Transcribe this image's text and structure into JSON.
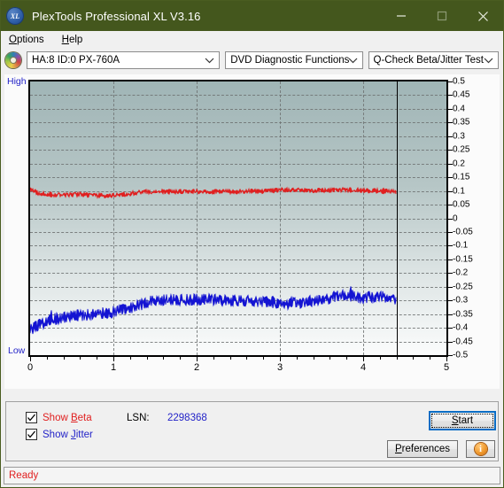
{
  "window": {
    "title": "PlexTools Professional XL V3.16",
    "app_icon": "xl-disc-icon",
    "icon_text": "XL",
    "titlebar_color": "#44571d",
    "minimize_label": "Minimize",
    "maximize_label": "Maximize",
    "close_label": "Close"
  },
  "menubar": {
    "items": [
      {
        "label": "Options",
        "accel": "O"
      },
      {
        "label": "Help",
        "accel": "H"
      }
    ]
  },
  "toolbar": {
    "drive_icon": "optical-disc-icon",
    "drive_combo": {
      "value": "HA:8 ID:0  PX-760A",
      "options": [
        "HA:8 ID:0  PX-760A"
      ]
    },
    "function_combo": {
      "value": "DVD Diagnostic Functions",
      "options": [
        "DVD Diagnostic Functions"
      ]
    },
    "test_combo": {
      "value": "Q-Check Beta/Jitter Test",
      "options": [
        "Q-Check Beta/Jitter Test"
      ]
    }
  },
  "chart_labels": {
    "high": "High",
    "low": "Low"
  },
  "controls": {
    "show_beta": {
      "label": "Show Beta",
      "accel": "B",
      "checked": true,
      "color": "#e02020"
    },
    "show_jitter": {
      "label": "Show Jitter",
      "accel": "J",
      "checked": true,
      "color": "#2323c8"
    },
    "lsn_label": "LSN:",
    "lsn_value": "2298368",
    "start_button": "Start",
    "start_accel": "S",
    "preferences_button": "Preferences",
    "preferences_accel": "P",
    "info_button": "i"
  },
  "statusbar": {
    "text": "Ready"
  },
  "chart_data": {
    "type": "line",
    "title": "Q-Check Beta/Jitter Test",
    "xlabel": "",
    "ylabel": "",
    "xlim": [
      0,
      5
    ],
    "ylim": [
      -0.5,
      0.5
    ],
    "xticks": [
      0,
      1,
      2,
      3,
      4,
      5
    ],
    "yticks": [
      0.5,
      0.45,
      0.4,
      0.35,
      0.3,
      0.25,
      0.2,
      0.15,
      0.1,
      0.05,
      0,
      -0.05,
      -0.1,
      -0.15,
      -0.2,
      -0.25,
      -0.3,
      -0.35,
      -0.4,
      -0.45,
      -0.5
    ],
    "ytick_labels": [
      "0.5",
      "0.45",
      "0.4",
      "0.35",
      "0.3",
      "0.25",
      "0.2",
      "0.15",
      "0.1",
      "0.05",
      "0",
      "-0.05",
      "-0.1",
      "-0.15",
      "-0.2",
      "-0.25",
      "-0.3",
      "-0.35",
      "-0.4",
      "-0.45",
      "-0.5"
    ],
    "xtick_labels": [
      "0",
      "1",
      "2",
      "3",
      "4",
      "5"
    ],
    "minor_xtick_step": 0.2,
    "grid": true,
    "grid_style": "dashed",
    "legend_position": "bottom-left-checkboxes",
    "data_end_x": 4.4,
    "marker_line_x": 4.4,
    "series": [
      {
        "name": "Beta",
        "color": "#e02020",
        "x": [
          0.0,
          0.1,
          0.2,
          0.3,
          0.4,
          0.5,
          0.6,
          0.7,
          0.8,
          0.9,
          1.0,
          1.1,
          1.2,
          1.3,
          1.4,
          1.5,
          1.6,
          1.7,
          1.8,
          1.9,
          2.0,
          2.1,
          2.2,
          2.3,
          2.4,
          2.5,
          2.6,
          2.7,
          2.8,
          2.9,
          3.0,
          3.1,
          3.2,
          3.3,
          3.4,
          3.5,
          3.6,
          3.7,
          3.8,
          3.9,
          4.0,
          4.1,
          4.2,
          4.3,
          4.4
        ],
        "values": [
          0.105,
          0.092,
          0.088,
          0.086,
          0.085,
          0.086,
          0.087,
          0.085,
          0.084,
          0.083,
          0.084,
          0.086,
          0.09,
          0.095,
          0.097,
          0.098,
          0.098,
          0.097,
          0.097,
          0.098,
          0.098,
          0.098,
          0.097,
          0.097,
          0.097,
          0.098,
          0.099,
          0.099,
          0.099,
          0.1,
          0.103,
          0.104,
          0.104,
          0.103,
          0.102,
          0.102,
          0.103,
          0.104,
          0.104,
          0.103,
          0.102,
          0.101,
          0.1,
          0.099,
          0.097
        ],
        "noise_amplitude": 0.009
      },
      {
        "name": "Jitter",
        "color": "#1414d2",
        "x": [
          0.0,
          0.1,
          0.2,
          0.3,
          0.4,
          0.5,
          0.6,
          0.7,
          0.8,
          0.9,
          1.0,
          1.1,
          1.2,
          1.3,
          1.4,
          1.5,
          1.6,
          1.7,
          1.8,
          1.9,
          2.0,
          2.1,
          2.2,
          2.3,
          2.4,
          2.5,
          2.6,
          2.7,
          2.8,
          2.9,
          3.0,
          3.1,
          3.2,
          3.3,
          3.4,
          3.5,
          3.6,
          3.7,
          3.8,
          3.9,
          4.0,
          4.1,
          4.2,
          4.3,
          4.4
        ],
        "values": [
          -0.405,
          -0.392,
          -0.378,
          -0.368,
          -0.362,
          -0.358,
          -0.355,
          -0.352,
          -0.348,
          -0.345,
          -0.342,
          -0.336,
          -0.328,
          -0.318,
          -0.306,
          -0.3,
          -0.299,
          -0.299,
          -0.298,
          -0.297,
          -0.296,
          -0.297,
          -0.298,
          -0.299,
          -0.299,
          -0.3,
          -0.301,
          -0.302,
          -0.304,
          -0.306,
          -0.31,
          -0.312,
          -0.31,
          -0.304,
          -0.3,
          -0.296,
          -0.29,
          -0.284,
          -0.276,
          -0.285,
          -0.292,
          -0.288,
          -0.286,
          -0.29,
          -0.296
        ],
        "noise_amplitude": 0.022
      }
    ]
  }
}
